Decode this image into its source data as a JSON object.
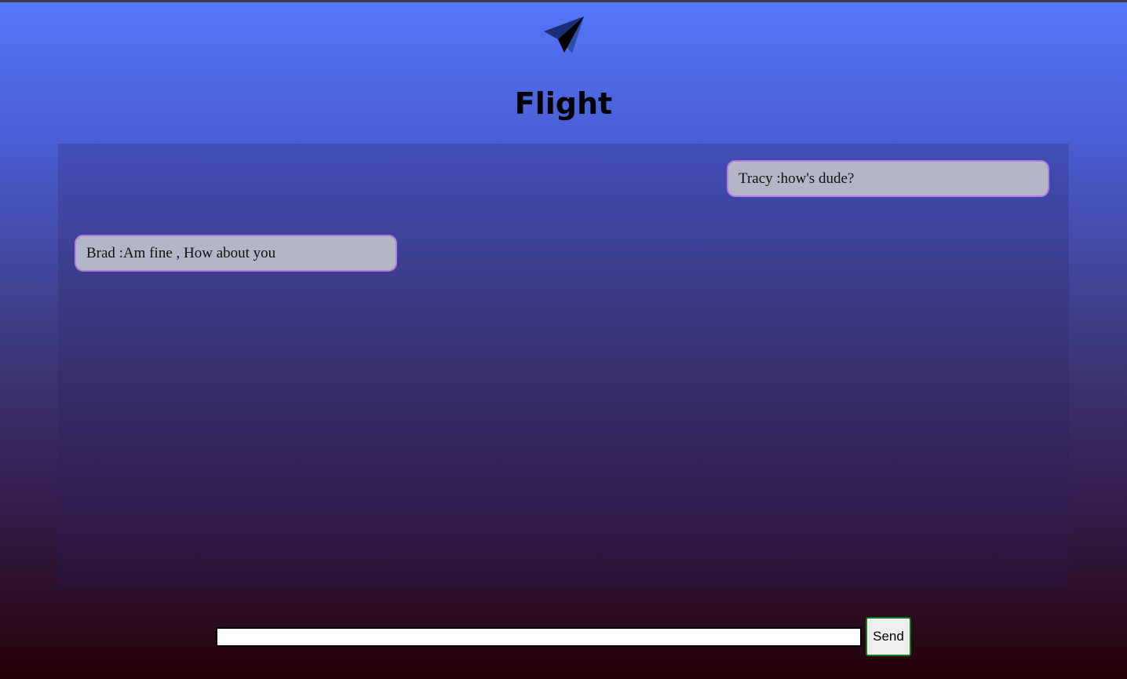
{
  "app": {
    "title": "Flight",
    "logo_icon": "paper-plane-icon"
  },
  "messages": [
    {
      "text": "Tracy :how's dude?",
      "side": "right"
    },
    {
      "text": "Brad :Am fine , How about you",
      "side": "left"
    }
  ],
  "composer": {
    "value": "",
    "placeholder": "",
    "send_label": "Send"
  },
  "colors": {
    "gradient_top": "#5577f9",
    "gradient_bottom": "#250005",
    "bubble_background": "#b3b6c6",
    "bubble_border": "#b57be0",
    "send_border": "#0c7a1c"
  }
}
